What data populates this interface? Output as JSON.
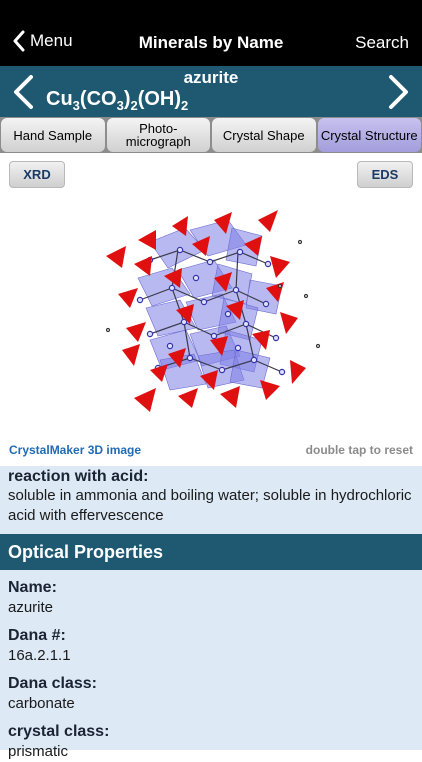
{
  "nav": {
    "back_label": "Menu",
    "title": "Minerals by Name",
    "search_label": "Search"
  },
  "mineral": {
    "name": "azurite"
  },
  "tabs": [
    {
      "label": "Hand Sample"
    },
    {
      "label": "Photo-\nmicrograph"
    },
    {
      "label": "Crystal Shape"
    },
    {
      "label": "Crystal Structure"
    }
  ],
  "buttons": {
    "xrd": "XRD",
    "eds": "EDS"
  },
  "viewer": {
    "link": "CrystalMaker 3D image",
    "hint": "double tap to reset"
  },
  "reaction": {
    "label": "reaction with acid:",
    "value": "soluble in ammonia and boiling water; soluble in hydrochloric acid with effervescence"
  },
  "optical": {
    "title": "Optical Properties"
  },
  "properties": [
    {
      "label": "Name:",
      "value": "azurite"
    },
    {
      "label": "Dana #:",
      "value": "16a.2.1.1"
    },
    {
      "label": "Dana class:",
      "value": "carbonate"
    },
    {
      "label": "crystal class:",
      "value": "prismatic"
    }
  ],
  "colors": {
    "header": "#1e5871",
    "active_tab": "#b2acea",
    "section_bg": "#dde9f4"
  }
}
